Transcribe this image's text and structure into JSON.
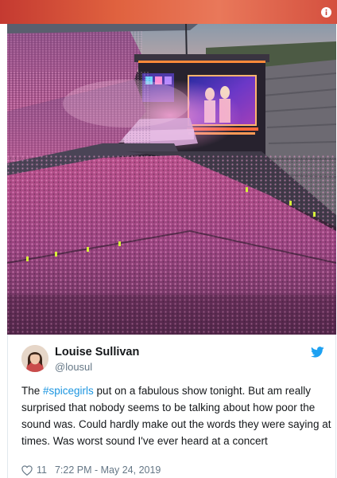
{
  "tweet": {
    "author_name": "Louise Sullivan",
    "handle": "@lousul",
    "text_before": "The ",
    "hashtag": "#spicegirls",
    "text_after": " put on a fabulous show tonight. But am really surprised that nobody seems to be talking about how poor the sound was. Could hardly make out the words they were saying at times. Was worst sound I've ever heard at a concert",
    "likes": "11",
    "timestamp": "7:22 PM - May 24, 2019"
  },
  "icons": {
    "info": "info-icon",
    "bird": "twitter-bird-icon",
    "heart": "heart-icon"
  },
  "colors": {
    "hashtag": "#1b95e0",
    "twitter_blue": "#1da1f2",
    "meta_text": "#657786"
  }
}
